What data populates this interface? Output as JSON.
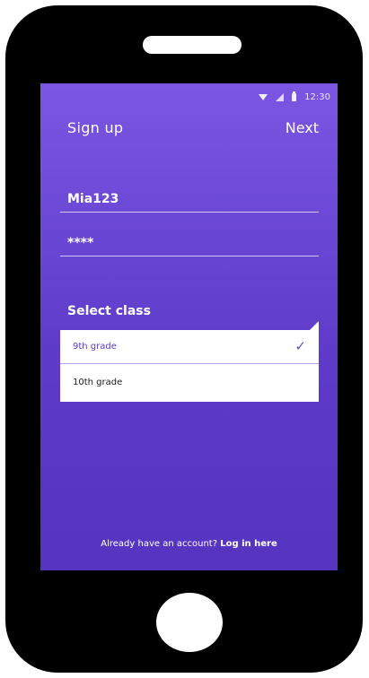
{
  "status_bar": {
    "time": "12:30"
  },
  "header": {
    "title": "Sign up",
    "next_label": "Next"
  },
  "form": {
    "username_value": "Mia123",
    "password_value": "****",
    "class_label": "Select class",
    "class_options": [
      {
        "label": "9th grade",
        "selected": true
      },
      {
        "label": "10th grade",
        "selected": false
      }
    ],
    "check_glyph": "✓"
  },
  "footer": {
    "prompt": "Already have an account?",
    "link_label": "Log in here"
  },
  "colors": {
    "gradient_top": "#7b56e3",
    "gradient_bottom": "#5534bf",
    "selected_text": "#5a3cc8"
  },
  "icons": [
    "wifi-icon",
    "signal-icon",
    "battery-icon",
    "check-icon"
  ]
}
